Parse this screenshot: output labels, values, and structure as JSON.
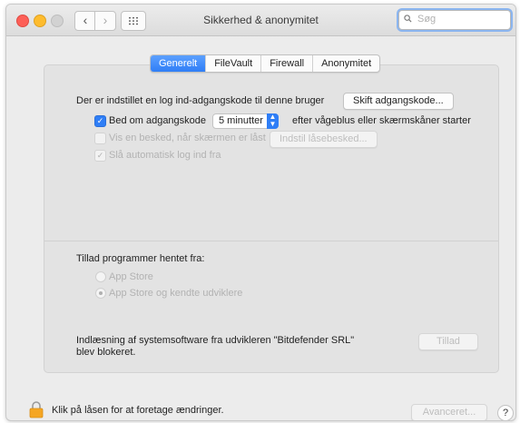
{
  "window": {
    "title": "Sikkerhed & anonymitet",
    "search_placeholder": "Søg"
  },
  "tabs": [
    {
      "label": "Generelt",
      "active": true
    },
    {
      "label": "FileVault",
      "active": false
    },
    {
      "label": "Firewall",
      "active": false
    },
    {
      "label": "Anonymitet",
      "active": false
    }
  ],
  "general": {
    "password_set_text": "Der er indstillet en log ind-adgangskode til denne bruger",
    "change_password_button": "Skift adgangskode...",
    "require_password_label": "Bed om adgangskode",
    "require_password_checked": true,
    "require_password_delay": "5 minutter",
    "require_password_suffix": "efter vågeblus eller skærmskåner starter",
    "show_message_label": "Vis en besked, når skærmen er låst",
    "show_message_checked": false,
    "set_lock_message_button": "Indstil låsebesked...",
    "disable_autologin_label": "Slå automatisk log ind fra",
    "disable_autologin_checked": true
  },
  "allow_apps": {
    "heading": "Tillad programmer hentet fra:",
    "options": [
      {
        "label": "App Store",
        "selected": false
      },
      {
        "label": "App Store og kendte udviklere",
        "selected": true
      }
    ]
  },
  "blocked": {
    "line1": "Indlæsning af systemsoftware fra udvikleren \"Bitdefender SRL\"",
    "line2": "blev blokeret.",
    "allow_button": "Tillad"
  },
  "footer": {
    "lock_text": "Klik på låsen for at foretage ændringer.",
    "advanced_button": "Avanceret...",
    "help_label": "?"
  },
  "colors": {
    "accent": "#2f7ef6",
    "close": "#fd5f57",
    "minimize": "#febc2e",
    "lock": "#f5a623"
  }
}
